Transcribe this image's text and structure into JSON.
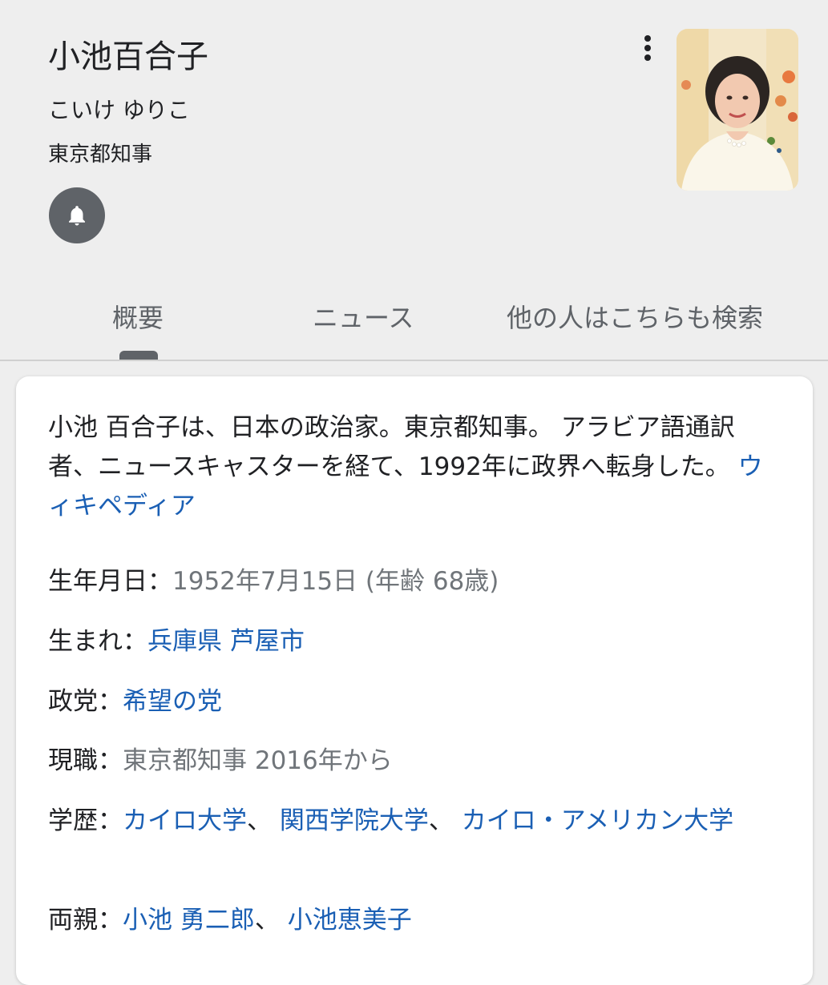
{
  "header": {
    "title": "小池百合子",
    "reading": "こいけ ゆりこ",
    "subtitle": "東京都知事",
    "bell_icon": "bell-icon",
    "more_icon": "more-vert-icon"
  },
  "tabs": [
    {
      "label": "概要",
      "selected": true
    },
    {
      "label": "ニュース",
      "selected": false
    },
    {
      "label": "他の人はこちらも検索",
      "selected": false
    }
  ],
  "description": {
    "text": "小池 百合子は、日本の政治家。東京都知事。 アラビア語通訳者、ニュースキャスターを経て、1992年に政界へ転身した。",
    "source_link": "ウィキペディア"
  },
  "facts": {
    "born": {
      "label": "生年月日：",
      "value": "1952年7月15日 (年齢 68歳)"
    },
    "birthplace": {
      "label": "生まれ：",
      "value": "兵庫県 芦屋市"
    },
    "party": {
      "label": "政党：",
      "value": "希望の党"
    },
    "office": {
      "label": "現職：",
      "value": "東京都知事 2016年から"
    },
    "education": {
      "label": "学歴：",
      "items": [
        "カイロ大学",
        "関西学院大学",
        "カイロ・アメリカン大学"
      ],
      "sep": "、 "
    },
    "parents": {
      "label": "両親：",
      "items": [
        "小池 勇二郎",
        "小池恵美子"
      ],
      "sep": "、 "
    }
  },
  "colors": {
    "link": "#1a5fb4",
    "header_bg": "#eeeeee",
    "icon_bg": "#5f6368"
  }
}
